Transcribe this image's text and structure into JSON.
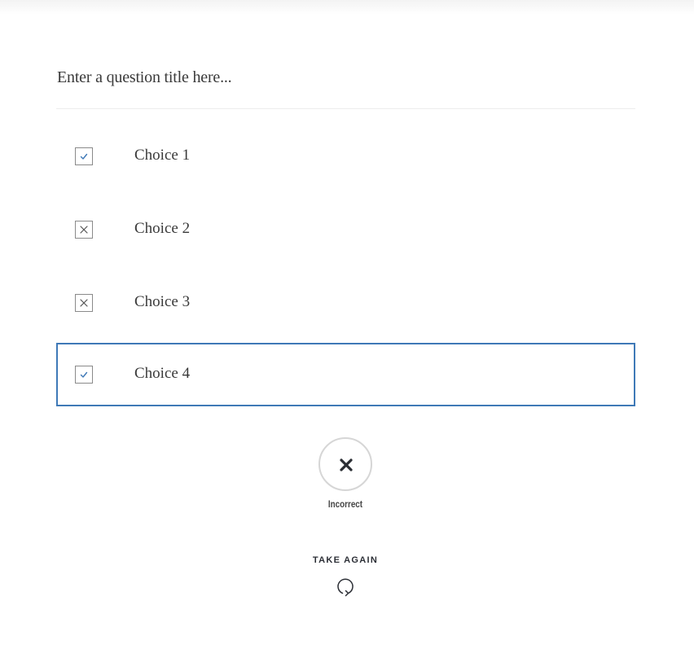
{
  "question": {
    "title": "Enter a question title here..."
  },
  "choices": [
    {
      "label": "Choice 1",
      "mark": "check",
      "selected": false
    },
    {
      "label": "Choice 2",
      "mark": "cross",
      "selected": false
    },
    {
      "label": "Choice 3",
      "mark": "cross",
      "selected": false
    },
    {
      "label": "Choice 4",
      "mark": "check",
      "selected": true
    }
  ],
  "result": {
    "status": "Incorrect",
    "icon": "x-icon"
  },
  "actions": {
    "take_again_label": "TAKE AGAIN",
    "take_again_icon": "refresh-icon"
  },
  "colors": {
    "accent": "#3f79b7",
    "text": "#333333",
    "border": "#8a8a8a"
  }
}
